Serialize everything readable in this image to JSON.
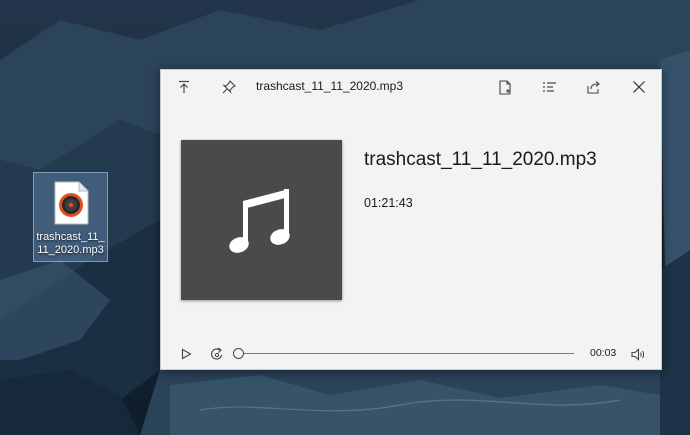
{
  "desktop": {
    "icon": {
      "name": "file-icon",
      "caption": "trashcast_11_11_2020.mp3",
      "icon_name": "music-disc-icon"
    }
  },
  "window": {
    "title": "trashcast_11_11_2020.mp3",
    "toolbar": {
      "left": [
        "pin-to-top-icon",
        "pin-icon"
      ],
      "right": [
        "open-file-icon",
        "details-icon",
        "share-icon",
        "close-icon"
      ]
    },
    "media": {
      "file_name": "trashcast_11_11_2020.mp3",
      "duration": "01:21:43",
      "art_icon": "music-note-icon"
    },
    "player": {
      "elapsed": "00:03",
      "progress": 0.0
    },
    "colors": {
      "window_bg": "#f3f3f3",
      "art_bg": "#4a4a4a",
      "icon": "#444444"
    }
  }
}
